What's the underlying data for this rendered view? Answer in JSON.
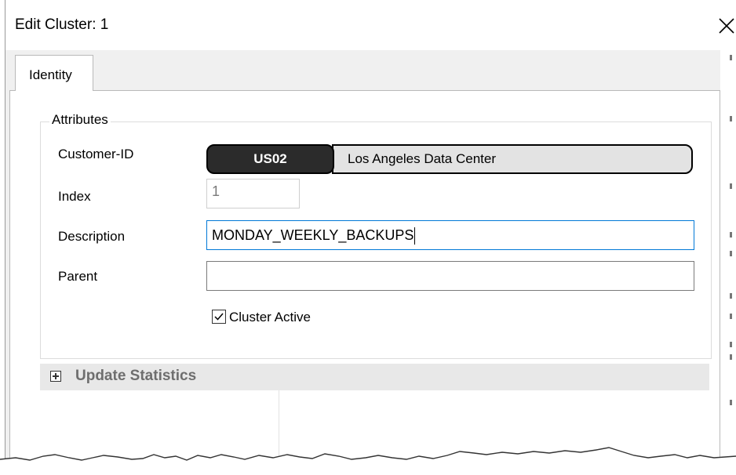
{
  "window": {
    "title": "Edit Cluster: 1",
    "close_icon": "close-icon"
  },
  "tabs": [
    {
      "label": "Identity",
      "active": true
    }
  ],
  "attributes": {
    "legend": "Attributes",
    "customer_id": {
      "label": "Customer-ID",
      "code": "US02",
      "name": "Los Angeles Data Center"
    },
    "index": {
      "label": "Index",
      "value": "1"
    },
    "description": {
      "label": "Description",
      "value": "MONDAY_WEEKLY_BACKUPS"
    },
    "parent": {
      "label": "Parent",
      "value": ""
    },
    "cluster_active": {
      "label": "Cluster Active",
      "checked": true
    }
  },
  "update_statistics": {
    "label": "Update Statistics",
    "icon": "expand-plus-icon",
    "expanded": false
  },
  "colors": {
    "focus_border": "#0078d7",
    "code_pill_bg": "#2b2b2b",
    "name_pill_bg": "#e3e3e3",
    "section_bar_bg": "#e8e8e8",
    "section_text": "#6e6e6e"
  }
}
